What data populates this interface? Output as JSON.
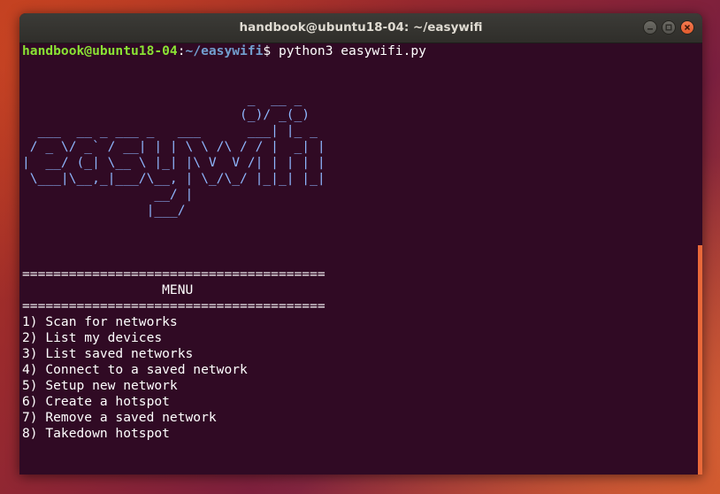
{
  "window": {
    "title": "handbook@ubuntu18-04: ~/easywifi"
  },
  "terminal": {
    "prompt_user": "handbook@ubuntu18-04",
    "prompt_sep": ":",
    "prompt_path": "~/easywifi",
    "prompt_symbol": "$ ",
    "command": "python3 easywifi.py",
    "banner": [
      "                             _  __ _ ",
      "                            (_)/ _(_)",
      "  ___  __ _ ___ _   ___      ___| |_ _ ",
      " / _ \\/ _` / __| | | \\ \\ /\\ / / |  _| |",
      "|  __/ (_| \\__ \\ |_| |\\ V  V /| | | | |",
      " \\___|\\__,_|___/\\__, | \\_/\\_/ |_|_| |_|",
      "                 __/ |",
      "                |___/"
    ],
    "separator": "=======================================",
    "menu_title": "                  MENU",
    "menu_items": [
      "1) Scan for networks",
      "2) List my devices",
      "3) List saved networks",
      "4) Connect to a saved network",
      "5) Setup new network",
      "6) Create a hotspot",
      "7) Remove a saved network",
      "8) Takedown hotspot"
    ],
    "input_prompt": ":"
  },
  "colors": {
    "terminal_bg": "#300a24",
    "prompt_user": "#8ae234",
    "prompt_path": "#729fcf",
    "banner": "#8fb8ff",
    "close_button": "#e05a2d"
  },
  "icons": {
    "minimize": "minimize-icon",
    "maximize": "maximize-icon",
    "close": "close-icon"
  }
}
